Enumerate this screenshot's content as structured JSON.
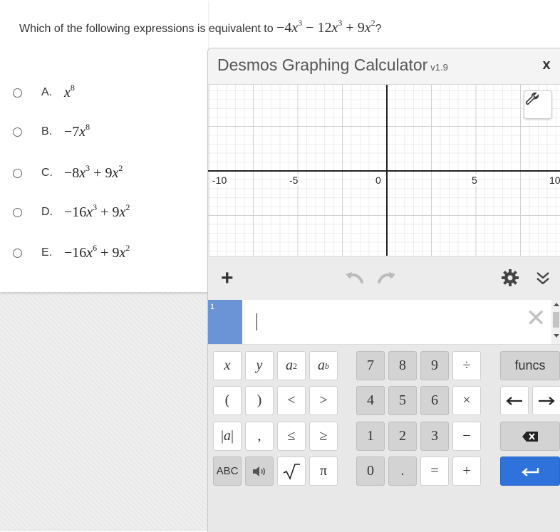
{
  "question": {
    "prefix": "Which of the following expressions is equivalent to ",
    "suffix": "?"
  },
  "choices": [
    {
      "letter": "A."
    },
    {
      "letter": "B."
    },
    {
      "letter": "C."
    },
    {
      "letter": "D."
    },
    {
      "letter": "E."
    }
  ],
  "desmos": {
    "title": "Desmos Graphing Calculator",
    "version": "v1.9",
    "close_label": "x",
    "graph": {
      "x_tick_labels": [
        "-10",
        "-5",
        "0",
        "5",
        "10"
      ]
    },
    "expression_list": {
      "index": "1",
      "value": ""
    },
    "keypad": {
      "funcs_label": "funcs",
      "abc_label": "ABC",
      "digits": [
        "7",
        "8",
        "9",
        "4",
        "5",
        "6",
        "1",
        "2",
        "3",
        "0",
        "."
      ]
    }
  },
  "colors": {
    "expression_index_bg": "#6b94d6",
    "enter_key_bg": "#2f72dc"
  }
}
